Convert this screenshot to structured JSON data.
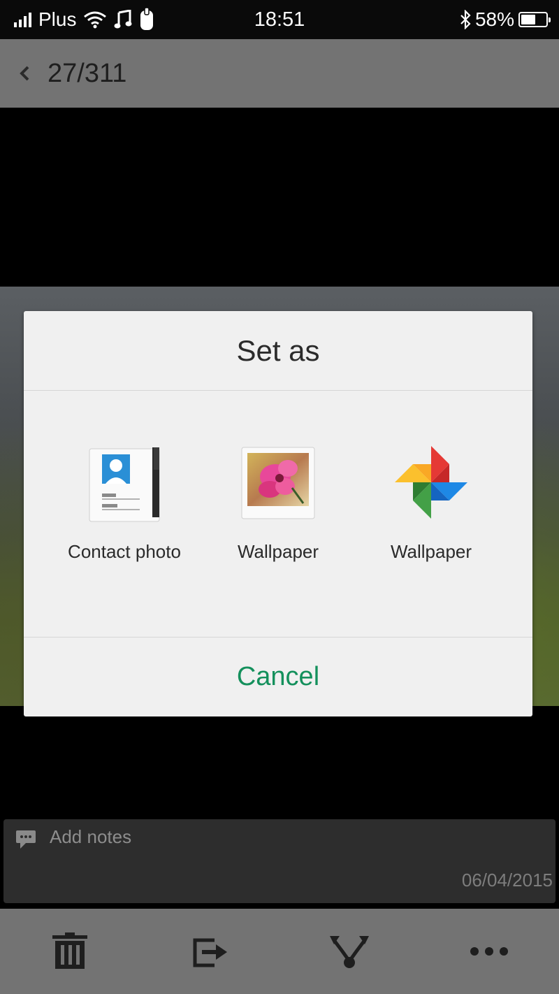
{
  "status_bar": {
    "carrier": "Plus",
    "time": "18:51",
    "battery": "58%",
    "battery_level": 0.58,
    "icons": [
      "signal-icon",
      "wifi-icon",
      "music-note-icon",
      "notification-icon",
      "bluetooth-icon",
      "battery-icon"
    ]
  },
  "header": {
    "back_icon": "chevron-left-icon",
    "counter": "27/311"
  },
  "dialog": {
    "title": "Set as",
    "options": [
      {
        "label": "Contact photo",
        "icon": "contacts-icon"
      },
      {
        "label": "Wallpaper",
        "icon": "gallery-wallpaper-icon"
      },
      {
        "label": "Wallpaper",
        "icon": "google-photos-icon"
      }
    ],
    "cancel_label": "Cancel",
    "accent_color": "#14905c"
  },
  "notes": {
    "placeholder": "Add notes",
    "date": "06/04/2015"
  },
  "toolbar": {
    "icons": [
      "trash-icon",
      "share-export-icon",
      "set-as-icon",
      "more-icon"
    ]
  }
}
